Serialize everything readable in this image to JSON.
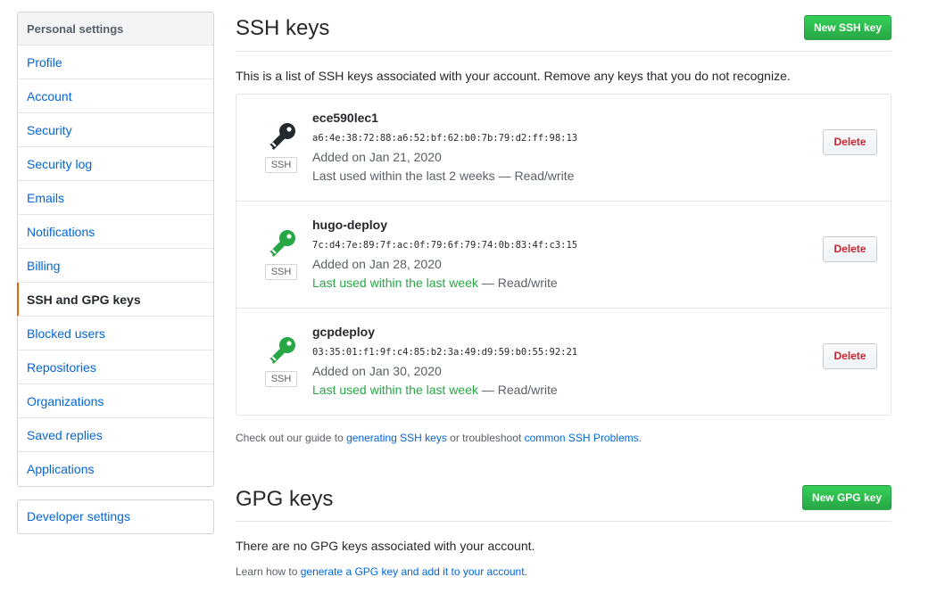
{
  "sidebar": {
    "heading": "Personal settings",
    "items": [
      {
        "label": "Profile"
      },
      {
        "label": "Account"
      },
      {
        "label": "Security"
      },
      {
        "label": "Security log"
      },
      {
        "label": "Emails"
      },
      {
        "label": "Notifications"
      },
      {
        "label": "Billing"
      },
      {
        "label": "SSH and GPG keys",
        "selected": true
      },
      {
        "label": "Blocked users"
      },
      {
        "label": "Repositories"
      },
      {
        "label": "Organizations"
      },
      {
        "label": "Saved replies"
      },
      {
        "label": "Applications"
      }
    ],
    "developer_settings": "Developer settings"
  },
  "ssh": {
    "title": "SSH keys",
    "new_button": "New SSH key",
    "intro": "This is a list of SSH keys associated with your account. Remove any keys that you do not recognize.",
    "keys": [
      {
        "title": "ece590lec1",
        "fingerprint": "a6:4e:38:72:88:a6:52:bf:62:b0:7b:79:d2:ff:98:13",
        "added": "Added on Jan 21, 2020",
        "last_used": "Last used within the last 2 weeks",
        "recent": false,
        "access": "— Read/write",
        "badge": "SSH",
        "icon_color": "#24292e",
        "delete_label": "Delete"
      },
      {
        "title": "hugo-deploy",
        "fingerprint": "7c:d4:7e:89:7f:ac:0f:79:6f:79:74:0b:83:4f:c3:15",
        "added": "Added on Jan 28, 2020",
        "last_used": "Last used within the last week",
        "recent": true,
        "access": "— Read/write",
        "badge": "SSH",
        "icon_color": "#28a745",
        "delete_label": "Delete"
      },
      {
        "title": "gcpdeploy",
        "fingerprint": "03:35:01:f1:9f:c4:85:b2:3a:49:d9:59:b0:55:92:21",
        "added": "Added on Jan 30, 2020",
        "last_used": "Last used within the last week",
        "recent": true,
        "access": "— Read/write",
        "badge": "SSH",
        "icon_color": "#28a745",
        "delete_label": "Delete"
      }
    ],
    "guide": {
      "prefix": "Check out our guide to",
      "link1": "generating SSH keys",
      "middle": "or troubleshoot",
      "link2": "common SSH Problems",
      "suffix": "."
    }
  },
  "gpg": {
    "title": "GPG keys",
    "new_button": "New GPG key",
    "empty": "There are no GPG keys associated with your account.",
    "learn": {
      "prefix": "Learn how to",
      "link": "generate a GPG key and add it to your account",
      "suffix": "."
    }
  },
  "colors": {
    "link": "#0366d6",
    "primary_green": "#28a745",
    "danger": "#cb2431",
    "selected_marker": "#e36209"
  }
}
